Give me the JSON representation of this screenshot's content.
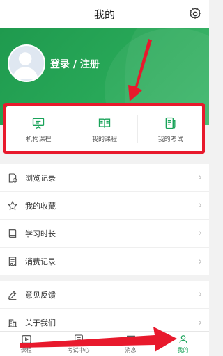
{
  "header": {
    "title": "我的",
    "settings_icon": "gear-icon"
  },
  "profile": {
    "login_text": "登录 / 注册",
    "avatar_icon": "avatar-icon"
  },
  "quick_links": [
    {
      "label": "机构课程",
      "icon": "presentation-board-icon"
    },
    {
      "label": "我的课程",
      "icon": "open-book-icon"
    },
    {
      "label": "我的考试",
      "icon": "exam-paper-pen-icon"
    }
  ],
  "menu_group_1": [
    {
      "label": "浏览记录",
      "icon": "history-icon"
    },
    {
      "label": "我的收藏",
      "icon": "star-icon"
    },
    {
      "label": "学习时长",
      "icon": "book-icon"
    },
    {
      "label": "消费记录",
      "icon": "receipt-icon"
    }
  ],
  "menu_group_2": [
    {
      "label": "意见反馈",
      "icon": "feedback-pen-icon"
    },
    {
      "label": "关于我们",
      "icon": "building-icon"
    }
  ],
  "chevron": "›",
  "tabbar": [
    {
      "label": "课程",
      "icon": "play-course-icon"
    },
    {
      "label": "考试中心",
      "icon": "exam-center-icon"
    },
    {
      "label": "消息",
      "icon": "message-icon"
    },
    {
      "label": "我的",
      "icon": "user-icon"
    }
  ],
  "colors": {
    "brand_green": "#1aa35a",
    "annotation_red": "#e8192c"
  }
}
